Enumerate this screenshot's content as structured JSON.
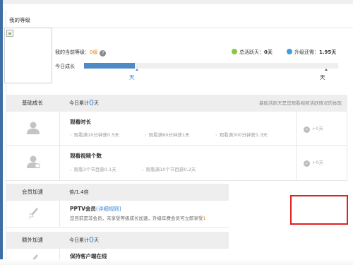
{
  "card": {
    "title": "我的等级"
  },
  "level": {
    "prefix": "我的当前等级：",
    "value": "0级",
    "help": "?"
  },
  "stats": {
    "active_label": "总活跃天：",
    "active_value": "0天",
    "upgrade_label": "升级还需：",
    "upgrade_value": "1.95天"
  },
  "growth": {
    "label": "今日成长",
    "progress_fraction": 0.2,
    "start_text": "天",
    "end_text": "天"
  },
  "sections": {
    "basic": {
      "title": "基础成长",
      "sub_prefix": "今日累计",
      "sub_value": "0",
      "sub_suffix": "天",
      "note": "基础活跃天是您观看视频活跃情况的体现"
    },
    "member": {
      "title": "会员加速",
      "sub": "倍/1.4倍"
    },
    "extra": {
      "title": "额外加速",
      "sub_prefix": "今日累计",
      "sub_value": "0",
      "sub_suffix": "天"
    }
  },
  "rows": {
    "watch_time": {
      "title": "观看时长",
      "items": [
        "观看满10分钟获0.5天",
        "观看满60分钟获1天",
        "观看满300分钟获1.3天"
      ],
      "reward": "+0天"
    },
    "watch_count": {
      "title": "观看视频个数",
      "items": [
        "观看3个节目获0.1天",
        "观看满10个节目获0.2天"
      ],
      "reward": "+0天"
    },
    "vip": {
      "title": "PPTV会员",
      "link": "(详细规则)",
      "desc": "您目前是非会员，未享受等级成长加速，升级年费会员可立即享受",
      "desc_num": "1"
    },
    "client": {
      "title": "保持客户端在线"
    }
  },
  "colors": {
    "accent_blue": "#3a86d6",
    "progress_fill": "#4f8ac6",
    "orange": "#f08300",
    "highlight_red": "#e02020"
  },
  "icons": {
    "help": "question-circle-icon",
    "active": "green-dot-icon",
    "upgrade": "blue-dot-icon",
    "row": "person-icon",
    "vip": "rocket-icon",
    "check": "check-circle-icon"
  }
}
